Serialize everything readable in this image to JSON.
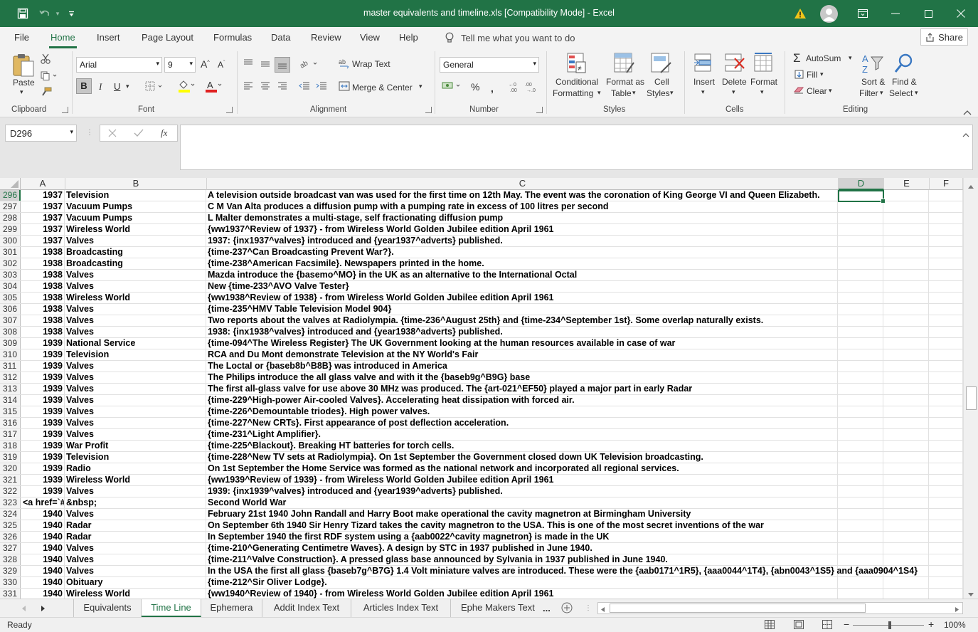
{
  "window": {
    "title": "master equivalents and timeline.xls  [Compatibility Mode]  -  Excel",
    "controls": {
      "ribbon_display": "ribbon-display-icon",
      "minimize": "minimize-icon",
      "maximize": "maximize-icon",
      "close": "close-icon"
    }
  },
  "menu": {
    "tabs": [
      "File",
      "Home",
      "Insert",
      "Page Layout",
      "Formulas",
      "Data",
      "Review",
      "View",
      "Help"
    ],
    "active": "Home",
    "tell_me": "Tell me what you want to do",
    "share": "Share"
  },
  "ribbon": {
    "clipboard": {
      "label": "Clipboard",
      "paste": "Paste"
    },
    "font": {
      "label": "Font",
      "name": "Arial",
      "size": "9"
    },
    "alignment": {
      "label": "Alignment",
      "wrap_text": "Wrap Text",
      "merge_center": "Merge & Center"
    },
    "number": {
      "label": "Number",
      "format": "General",
      "percent": "%"
    },
    "styles": {
      "label": "Styles",
      "conditional": "Conditional",
      "conditional2": "Formatting",
      "format_as": "Format as",
      "format_as2": "Table",
      "cell": "Cell",
      "cell2": "Styles"
    },
    "cells": {
      "label": "Cells",
      "insert": "Insert",
      "delete": "Delete",
      "format": "Format"
    },
    "editing": {
      "label": "Editing",
      "autosum": "AutoSum",
      "fill": "Fill",
      "clear": "Clear",
      "sort": "Sort &",
      "sort2": "Filter",
      "find": "Find &",
      "find2": "Select"
    }
  },
  "formula_bar": {
    "name_box": "D296",
    "formula": ""
  },
  "grid": {
    "columns": [
      "A",
      "B",
      "C",
      "D",
      "E",
      "F"
    ],
    "selected_column": "D",
    "selected_cell": "D296",
    "rows": [
      {
        "n": "296",
        "a": "1937",
        "b": "Television",
        "c": "A television outside broadcast van was used for the first time on 12th May. The event was the coronation of King George VI and Queen Elizabeth."
      },
      {
        "n": "297",
        "a": "1937",
        "b": "Vacuum Pumps",
        "c": "C M Van Alta produces a diffusion pump with a pumping rate in excess of 100 litres per second"
      },
      {
        "n": "298",
        "a": "1937",
        "b": "Vacuum Pumps",
        "c": "L Malter demonstrates a multi-stage, self fractionating diffusion pump"
      },
      {
        "n": "299",
        "a": "1937",
        "b": "Wireless World",
        "c": "{ww1937^Review of 1937} - from Wireless World Golden Jubilee edition April 1961"
      },
      {
        "n": "300",
        "a": "1937",
        "b": "Valves",
        "c": "1937:  {inx1937^valves} introduced and {year1937^adverts} published."
      },
      {
        "n": "301",
        "a": "1938",
        "b": "Broadcasting",
        "c": "{time-237^Can Broadcasting Prevent War?}."
      },
      {
        "n": "302",
        "a": "1938",
        "b": "Broadcasting",
        "c": "{time-238^American Facsimile}. Newspapers printed in the home."
      },
      {
        "n": "303",
        "a": "1938",
        "b": "Valves",
        "c": "Mazda introduce the {basemo^MO} in the UK as an alternative to the International Octal"
      },
      {
        "n": "304",
        "a": "1938",
        "b": "Valves",
        "c": "New {time-233^AVO Valve Tester}"
      },
      {
        "n": "305",
        "a": "1938",
        "b": "Wireless World",
        "c": "{ww1938^Review of 1938} - from Wireless World Golden Jubilee edition April 1961"
      },
      {
        "n": "306",
        "a": "1938",
        "b": "Valves",
        "c": "{time-235^HMV Table Television Model 904}"
      },
      {
        "n": "307",
        "a": "1938",
        "b": "Valves",
        "c": "Two reports about the valves at Radiolympia. {time-236^August 25th} and {time-234^September 1st}. Some overlap naturally exists."
      },
      {
        "n": "308",
        "a": "1938",
        "b": "Valves",
        "c": "1938:  {inx1938^valves} introduced and {year1938^adverts} published."
      },
      {
        "n": "309",
        "a": "1939",
        "b": "National Service",
        "c": "{time-094^The Wireless Register} The UK Government looking at the human resources available in case of war"
      },
      {
        "n": "310",
        "a": "1939",
        "b": "Television",
        "c": "RCA and Du Mont demonstrate Television at the NY World's Fair"
      },
      {
        "n": "311",
        "a": "1939",
        "b": "Valves",
        "c": "The Loctal or {baseb8b^B8B} was introduced in America"
      },
      {
        "n": "312",
        "a": "1939",
        "b": "Valves",
        "c": "The Philips introduce the all glass valve and with it the {baseb9g^B9G} base"
      },
      {
        "n": "313",
        "a": "1939",
        "b": "Valves",
        "c": "The first all-glass valve for use above 30 MHz was produced. The {art-021^EF50} played a major part in early Radar"
      },
      {
        "n": "314",
        "a": "1939",
        "b": "Valves",
        "c": "{time-229^High-power Air-cooled Valves}. Accelerating heat dissipation with forced air."
      },
      {
        "n": "315",
        "a": "1939",
        "b": "Valves",
        "c": "{time-226^Demountable triodes}. High power valves."
      },
      {
        "n": "316",
        "a": "1939",
        "b": "Valves",
        "c": "{time-227^New CRTs}. First appearance of post deflection acceleration."
      },
      {
        "n": "317",
        "a": "1939",
        "b": "Valves",
        "c": "{time-231^Light Amplifier}."
      },
      {
        "n": "318",
        "a": "1939",
        "b": "War Profit",
        "c": "{time-225^Blackout}. Breaking HT batteries for torch cells."
      },
      {
        "n": "319",
        "a": "1939",
        "b": "Television",
        "c": "{time-228^New TV sets at Radiolympia}. On 1st September the Government closed down UK Television broadcasting."
      },
      {
        "n": "320",
        "a": "1939",
        "b": "Radio",
        "c": "On 1st September the Home Service was formed as the national network and incorporated all regional services."
      },
      {
        "n": "321",
        "a": "1939",
        "b": "Wireless World",
        "c": "{ww1939^Review of 1939} - from Wireless World Golden Jubilee edition April 1961"
      },
      {
        "n": "322",
        "a": "1939",
        "b": "Valves",
        "c": "1939:  {inx1939^valves} introduced and {year1939^adverts} published."
      },
      {
        "n": "323",
        "a": "<a href=`#t",
        "b": "&nbsp;",
        "c": "Second World War",
        "a_left": true
      },
      {
        "n": "324",
        "a": "1940",
        "b": "Valves",
        "c": "February 21st 1940 John Randall and Harry Boot make operational the cavity magnetron at Birmingham University"
      },
      {
        "n": "325",
        "a": "1940",
        "b": "Radar",
        "c": "On September 6th 1940 Sir Henry Tizard takes the cavity magnetron to the USA. This is one of the most secret inventions of the war"
      },
      {
        "n": "326",
        "a": "1940",
        "b": "Radar",
        "c": "In September 1940 the first RDF system using a {aab0022^cavity magnetron} is made in the UK"
      },
      {
        "n": "327",
        "a": "1940",
        "b": "Valves",
        "c": "{time-210^Generating Centimetre Waves}. A design by STC in 1937 published in June 1940."
      },
      {
        "n": "328",
        "a": "1940",
        "b": "Valves",
        "c": "{time-211^Valve Construction}. A pressed glass base announced by Sylvania in 1937 published in June 1940."
      },
      {
        "n": "329",
        "a": "1940",
        "b": "Valves",
        "c": "In the USA the first all glass {baseb7g^B7G} 1.4 Volt miniature valves are introduced. These were the {aab0171^1R5}, {aaa0044^1T4}, {abn0043^1S5} and {aaa0904^1S4}"
      },
      {
        "n": "330",
        "a": "1940",
        "b": "Obituary",
        "c": "{time-212^Sir Oliver Lodge}."
      },
      {
        "n": "331",
        "a": "1940",
        "b": "Wireless World",
        "c": "{ww1940^Review of 1940} - from Wireless World Golden Jubilee edition April 1961"
      }
    ]
  },
  "sheets": {
    "tabs": [
      "Equivalents",
      "Time Line",
      "Ephemera",
      "Addit Index Text",
      "Articles Index Text",
      "Ephe Makers Text"
    ],
    "active": "Time Line",
    "more": "..."
  },
  "status": {
    "text": "Ready",
    "zoom": "100%"
  }
}
